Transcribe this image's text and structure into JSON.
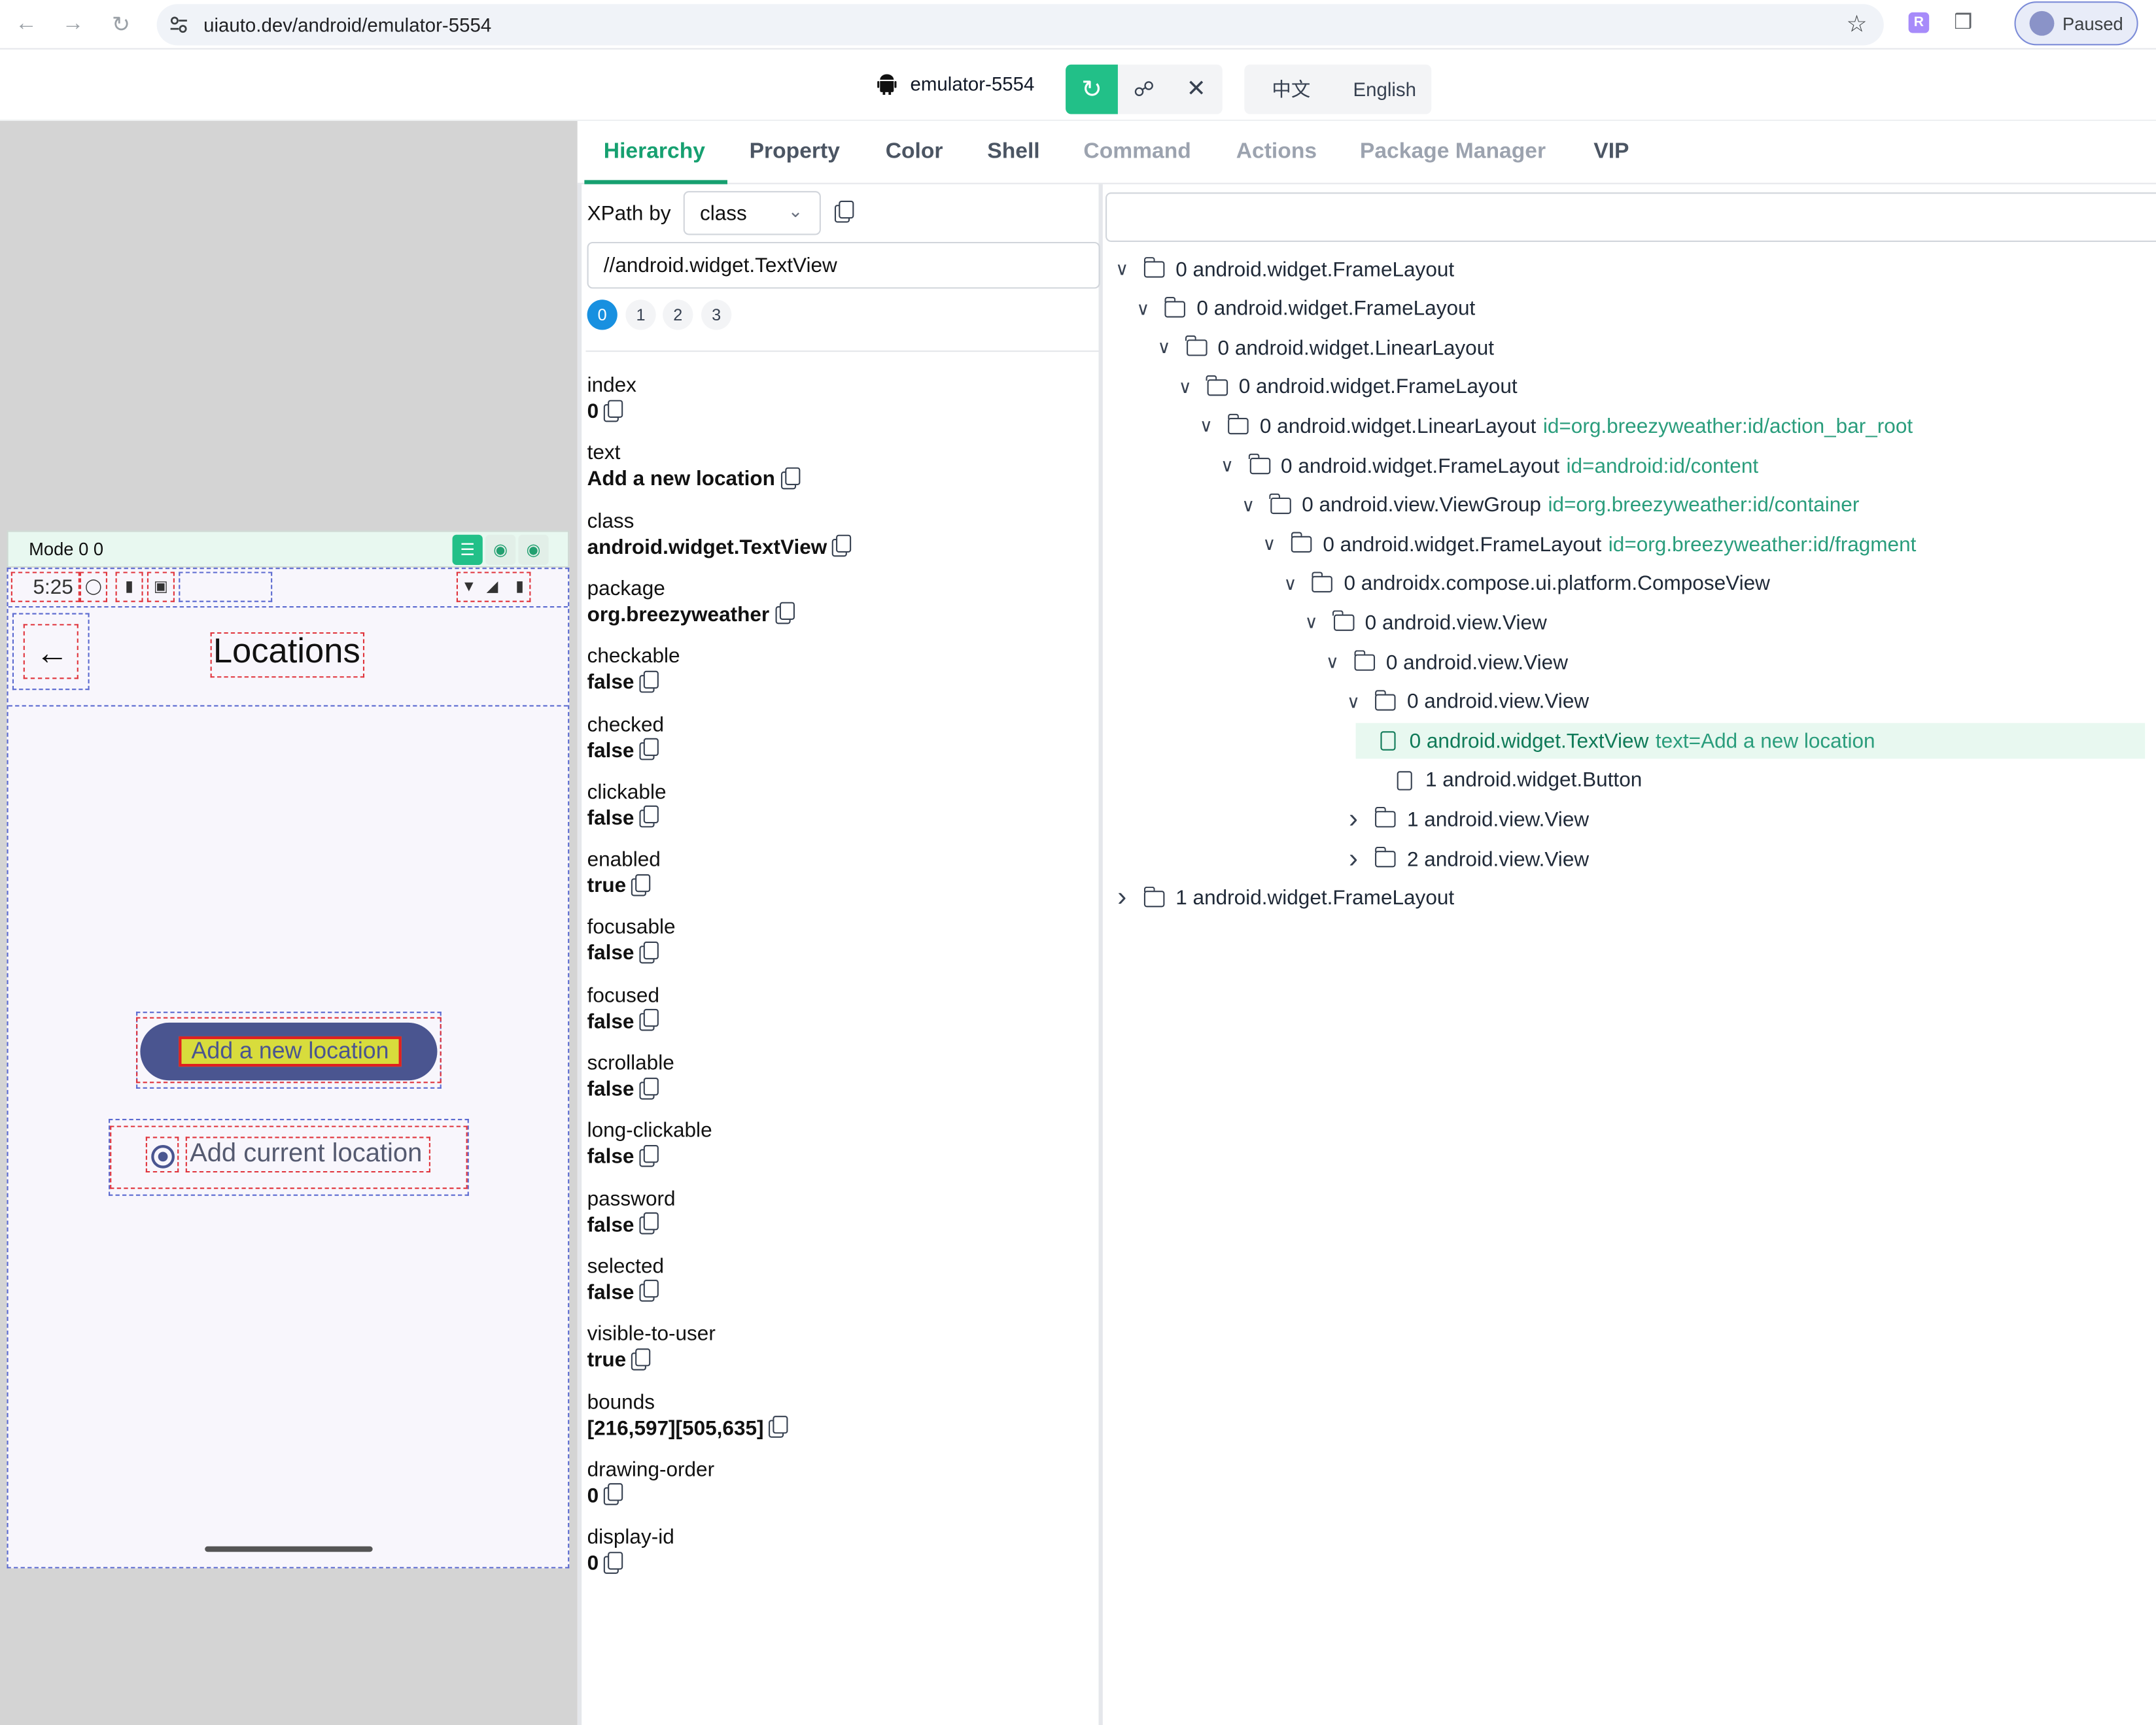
{
  "browser": {
    "url": "uiauto.dev/android/emulator-5554",
    "ext_letter": "R",
    "profile_status": "Paused"
  },
  "appbar": {
    "device": "emulator-5554",
    "lang_zh": "中文",
    "lang_en": "English"
  },
  "tabs": [
    "Hierarchy",
    "Property",
    "Color",
    "Shell",
    "Command",
    "Actions",
    "Package Manager",
    "VIP"
  ],
  "device_panel": {
    "mode": "Mode 0 0",
    "time": "5:25",
    "screen_title": "Locations",
    "add_button": "Add a new location",
    "add_current": "Add current location"
  },
  "xpath": {
    "label": "XPath by",
    "by": "class",
    "expression": "//android.widget.TextView",
    "matches": [
      "0",
      "1",
      "2",
      "3"
    ]
  },
  "properties": [
    {
      "key": "index",
      "value": "0"
    },
    {
      "key": "text",
      "value": "Add a new location"
    },
    {
      "key": "class",
      "value": "android.widget.TextView"
    },
    {
      "key": "package",
      "value": "org.breezyweather"
    },
    {
      "key": "checkable",
      "value": "false"
    },
    {
      "key": "checked",
      "value": "false"
    },
    {
      "key": "clickable",
      "value": "false"
    },
    {
      "key": "enabled",
      "value": "true"
    },
    {
      "key": "focusable",
      "value": "false"
    },
    {
      "key": "focused",
      "value": "false"
    },
    {
      "key": "scrollable",
      "value": "false"
    },
    {
      "key": "long-clickable",
      "value": "false"
    },
    {
      "key": "password",
      "value": "false"
    },
    {
      "key": "selected",
      "value": "false"
    },
    {
      "key": "visible-to-user",
      "value": "true"
    },
    {
      "key": "bounds",
      "value": "[216,597][505,635]"
    },
    {
      "key": "drawing-order",
      "value": "0"
    },
    {
      "key": "display-id",
      "value": "0"
    }
  ],
  "tree": [
    {
      "label": "0 android.widget.FrameLayout",
      "attr": ""
    },
    {
      "label": "0 android.widget.FrameLayout",
      "attr": ""
    },
    {
      "label": "0 android.widget.LinearLayout",
      "attr": ""
    },
    {
      "label": "0 android.widget.FrameLayout",
      "attr": ""
    },
    {
      "label": "0 android.widget.LinearLayout",
      "attr": "id=org.breezyweather:id/action_bar_root"
    },
    {
      "label": "0 android.widget.FrameLayout",
      "attr": "id=android:id/content"
    },
    {
      "label": "0 android.view.ViewGroup",
      "attr": "id=org.breezyweather:id/container"
    },
    {
      "label": "0 android.widget.FrameLayout",
      "attr": "id=org.breezyweather:id/fragment"
    },
    {
      "label": "0 androidx.compose.ui.platform.ComposeView",
      "attr": ""
    },
    {
      "label": "0 android.view.View",
      "attr": ""
    },
    {
      "label": "0 android.view.View",
      "attr": ""
    },
    {
      "label": "0 android.view.View",
      "attr": ""
    },
    {
      "label": "0 android.widget.TextView",
      "attr": "text=Add a new location"
    },
    {
      "label": "1 android.widget.Button",
      "attr": ""
    },
    {
      "label": "1 android.view.View",
      "attr": ""
    },
    {
      "label": "2 android.view.View",
      "attr": ""
    },
    {
      "label": "1 android.widget.FrameLayout",
      "attr": ""
    }
  ],
  "colors": {
    "accent": "#16a070",
    "selected_match": "#1890e0",
    "button_fill": "#4a5590"
  }
}
